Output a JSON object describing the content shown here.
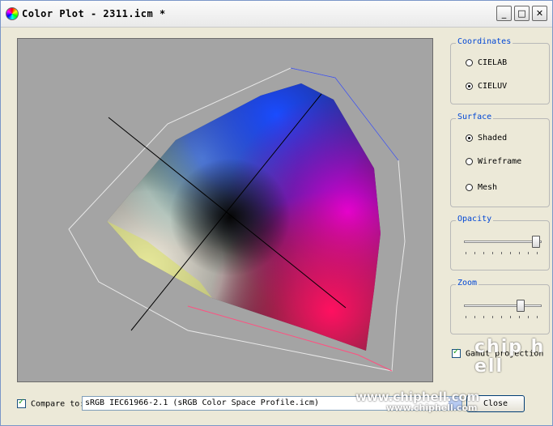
{
  "window": {
    "title": "Color Plot - 2311.icm *",
    "minimize_label": "_",
    "maximize_label": "□",
    "close_label": "✕"
  },
  "coordinates": {
    "legend": "Coordinates",
    "options": [
      {
        "label": "CIELAB",
        "selected": false
      },
      {
        "label": "CIELUV",
        "selected": true
      }
    ]
  },
  "surface": {
    "legend": "Surface",
    "options": [
      {
        "label": "Shaded",
        "selected": true
      },
      {
        "label": "Wireframe",
        "selected": false
      },
      {
        "label": "Mesh",
        "selected": false
      }
    ]
  },
  "opacity": {
    "legend": "Opacity",
    "value": 0.98
  },
  "zoom": {
    "legend": "Zoom",
    "value": 0.75
  },
  "gamut_projection": {
    "label": "Gamut projection",
    "checked": true
  },
  "compare": {
    "label": "Compare to:",
    "checked": true,
    "selected_profile": "sRGB IEC61966-2.1 (sRGB Color Space Profile.icm)"
  },
  "close_button": "Close",
  "watermark": {
    "url1": "www.chiphell.com",
    "url2": "www.chiphell.com",
    "logo": "chip hell"
  },
  "colors": {
    "plot_bg": "#a4a4a4",
    "legend_blue": "#0046d5"
  }
}
